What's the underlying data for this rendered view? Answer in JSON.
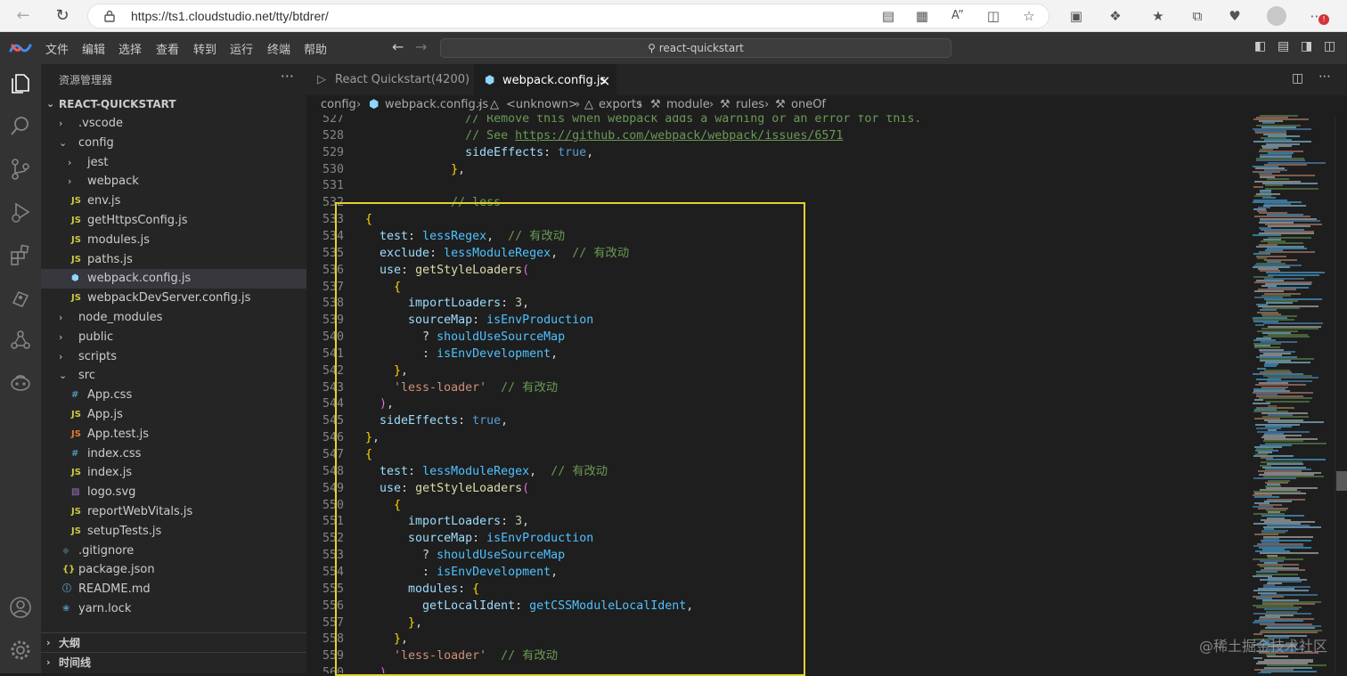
{
  "browser": {
    "url": "https://ts1.cloudstudio.net/tty/btdrer/"
  },
  "menubar": {
    "items": [
      "文件",
      "编辑",
      "选择",
      "查看",
      "转到",
      "运行",
      "终端",
      "帮助"
    ],
    "command_center": "react-quickstart"
  },
  "sidebar": {
    "title": "资源管理器",
    "more": "···",
    "root": "REACT-QUICKSTART",
    "tree": [
      {
        "label": ".vscode",
        "kind": "folder",
        "depth": 1,
        "open": false
      },
      {
        "label": "config",
        "kind": "folder",
        "depth": 1,
        "open": true
      },
      {
        "label": "jest",
        "kind": "folder",
        "depth": 2,
        "open": false
      },
      {
        "label": "webpack",
        "kind": "folder",
        "depth": 2,
        "open": false
      },
      {
        "label": "env.js",
        "kind": "js",
        "depth": 2
      },
      {
        "label": "getHttpsConfig.js",
        "kind": "js",
        "depth": 2
      },
      {
        "label": "modules.js",
        "kind": "js",
        "depth": 2
      },
      {
        "label": "paths.js",
        "kind": "js",
        "depth": 2
      },
      {
        "label": "webpack.config.js",
        "kind": "webpack",
        "depth": 2,
        "selected": true
      },
      {
        "label": "webpackDevServer.config.js",
        "kind": "js",
        "depth": 2
      },
      {
        "label": "node_modules",
        "kind": "folder",
        "depth": 1,
        "open": false
      },
      {
        "label": "public",
        "kind": "folder",
        "depth": 1,
        "open": false
      },
      {
        "label": "scripts",
        "kind": "folder",
        "depth": 1,
        "open": false
      },
      {
        "label": "src",
        "kind": "folder",
        "depth": 1,
        "open": true
      },
      {
        "label": "App.css",
        "kind": "css",
        "depth": 2
      },
      {
        "label": "App.js",
        "kind": "js",
        "depth": 2
      },
      {
        "label": "App.test.js",
        "kind": "jstest",
        "depth": 2
      },
      {
        "label": "index.css",
        "kind": "css",
        "depth": 2
      },
      {
        "label": "index.js",
        "kind": "js",
        "depth": 2
      },
      {
        "label": "logo.svg",
        "kind": "svg",
        "depth": 2
      },
      {
        "label": "reportWebVitals.js",
        "kind": "js",
        "depth": 2
      },
      {
        "label": "setupTests.js",
        "kind": "js",
        "depth": 2
      },
      {
        "label": ".gitignore",
        "kind": "git",
        "depth": 1
      },
      {
        "label": "package.json",
        "kind": "json",
        "depth": 1
      },
      {
        "label": "README.md",
        "kind": "info",
        "depth": 1
      },
      {
        "label": "yarn.lock",
        "kind": "yarn",
        "depth": 1
      }
    ],
    "sections": [
      "大纲",
      "时间线"
    ]
  },
  "tabs": [
    {
      "label": "React Quickstart(4200)",
      "active": false
    },
    {
      "label": "webpack.config.js",
      "active": true,
      "close": "×"
    }
  ],
  "breadcrumb": [
    "config",
    "webpack.config.js",
    "<unknown>",
    "exports",
    "module",
    "rules",
    "oneOf"
  ],
  "code": [
    {
      "n": "527",
      "t": "              // Remove this when webpack adds a warning or an error for this."
    },
    {
      "n": "528",
      "t": "              // See https://github.com/webpack/webpack/issues/6571"
    },
    {
      "n": "529",
      "t": "              sideEffects: true,"
    },
    {
      "n": "530",
      "t": "            },"
    },
    {
      "n": "531",
      "t": ""
    },
    {
      "n": "532",
      "t": "            // less"
    },
    {
      "n": "533",
      "t": "{"
    },
    {
      "n": "534",
      "t": "  test: lessRegex,  // 有改动"
    },
    {
      "n": "535",
      "t": "  exclude: lessModuleRegex,  // 有改动"
    },
    {
      "n": "536",
      "t": "  use: getStyleLoaders("
    },
    {
      "n": "537",
      "t": "    {"
    },
    {
      "n": "538",
      "t": "      importLoaders: 3,"
    },
    {
      "n": "539",
      "t": "      sourceMap: isEnvProduction"
    },
    {
      "n": "540",
      "t": "        ? shouldUseSourceMap"
    },
    {
      "n": "541",
      "t": "        : isEnvDevelopment,"
    },
    {
      "n": "542",
      "t": "    },"
    },
    {
      "n": "543",
      "t": "    'less-loader'  // 有改动"
    },
    {
      "n": "544",
      "t": "  ),"
    },
    {
      "n": "545",
      "t": "  sideEffects: true,"
    },
    {
      "n": "546",
      "t": "},"
    },
    {
      "n": "547",
      "t": "{"
    },
    {
      "n": "548",
      "t": "  test: lessModuleRegex,  // 有改动"
    },
    {
      "n": "549",
      "t": "  use: getStyleLoaders("
    },
    {
      "n": "550",
      "t": "    {"
    },
    {
      "n": "551",
      "t": "      importLoaders: 3,"
    },
    {
      "n": "552",
      "t": "      sourceMap: isEnvProduction"
    },
    {
      "n": "553",
      "t": "        ? shouldUseSourceMap"
    },
    {
      "n": "554",
      "t": "        : isEnvDevelopment,"
    },
    {
      "n": "555",
      "t": "      modules: {"
    },
    {
      "n": "556",
      "t": "        getLocalIdent: getCSSModuleLocalIdent,"
    },
    {
      "n": "557",
      "t": "      },"
    },
    {
      "n": "558",
      "t": "    },"
    },
    {
      "n": "559",
      "t": "    'less-loader'  // 有改动"
    },
    {
      "n": "560",
      "t": "  ),"
    }
  ],
  "watermark": "@稀土掘金技术社区",
  "colors": {
    "accent": "#007acc",
    "highlight_box": "#e4d12f",
    "js_icon": "#cbcb41",
    "css_icon": "#519aba"
  }
}
